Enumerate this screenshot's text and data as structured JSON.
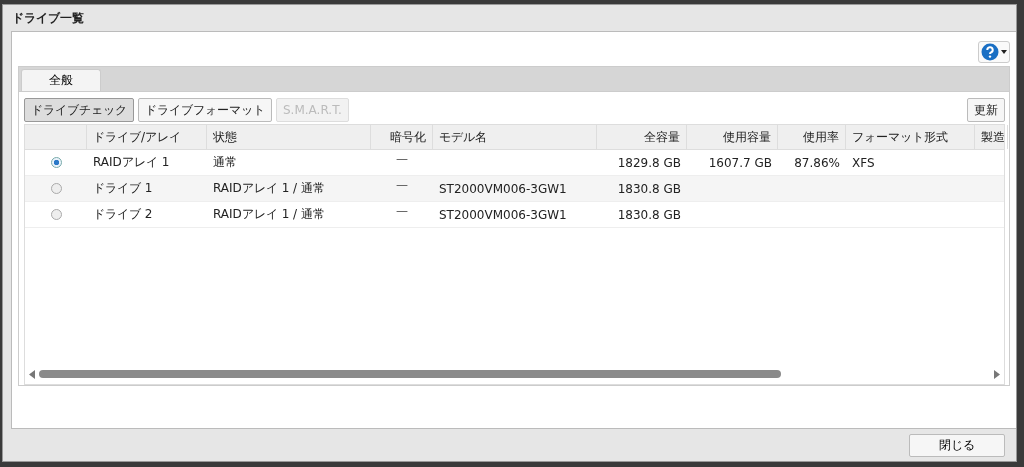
{
  "window": {
    "title": "ドライブ一覧"
  },
  "tabs": [
    {
      "label": "全般",
      "selected": true
    }
  ],
  "toolbar": {
    "buttons": [
      {
        "label": "ドライブチェック",
        "pressed": true,
        "disabled": false
      },
      {
        "label": "ドライブフォーマット",
        "pressed": false,
        "disabled": false
      },
      {
        "label": "S.M.A.R.T.",
        "pressed": false,
        "disabled": true
      }
    ],
    "refresh": "更新"
  },
  "table": {
    "columns": [
      "ドライブ/アレイ",
      "状態",
      "暗号化",
      "モデル名",
      "全容量",
      "使用容量",
      "使用率",
      "フォーマット形式",
      "製造"
    ],
    "rows": [
      {
        "selected": true,
        "cells": [
          "RAIDアレイ 1",
          "通常",
          "—",
          "",
          "1829.8 GB",
          "1607.7 GB",
          "87.86%",
          "XFS",
          ""
        ]
      },
      {
        "selected": false,
        "cells": [
          "ドライブ 1",
          "RAIDアレイ 1 / 通常",
          "—",
          "ST2000VM006-3GW1",
          "1830.8 GB",
          "",
          "",
          "",
          ""
        ]
      },
      {
        "selected": false,
        "cells": [
          "ドライブ 2",
          "RAIDアレイ 1 / 通常",
          "—",
          "ST2000VM006-3GW1",
          "1830.8 GB",
          "",
          "",
          "",
          ""
        ]
      }
    ]
  },
  "footer": {
    "close": "閉じる"
  }
}
